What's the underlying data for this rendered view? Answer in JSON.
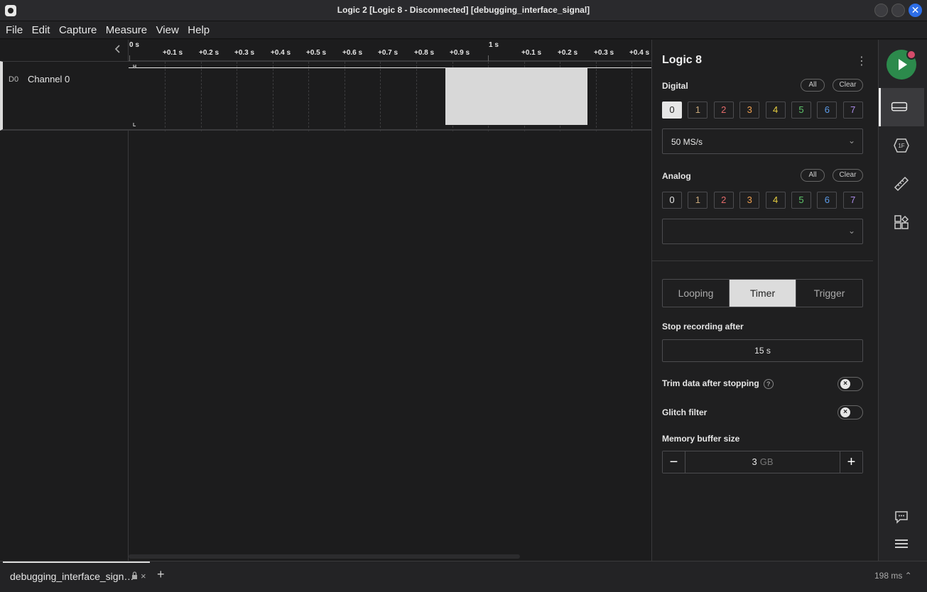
{
  "window": {
    "title": "Logic 2 [Logic 8 - Disconnected] [debugging_interface_signal]",
    "close_glyph": "✕"
  },
  "menu": [
    "File",
    "Edit",
    "Capture",
    "Measure",
    "View",
    "Help"
  ],
  "ruler": {
    "zero_label": "0 s",
    "second_label": "1 s",
    "ticks": [
      "+0.1 s",
      "+0.2 s",
      "+0.3 s",
      "+0.4 s",
      "+0.5 s",
      "+0.6 s",
      "+0.7 s",
      "+0.8 s",
      "+0.9 s",
      "+0.1 s",
      "+0.2 s",
      "+0.3 s",
      "+0.4 s"
    ]
  },
  "channel": {
    "id": "D0",
    "name": "Channel 0",
    "high_marker": "H",
    "low_marker": "L"
  },
  "panel": {
    "device": "Logic 8",
    "kebab": "⋮",
    "digital": {
      "label": "Digital",
      "all": "All",
      "clear": "Clear",
      "channels": [
        {
          "label": "0",
          "color": "#e6e6e6",
          "active": true
        },
        {
          "label": "1",
          "color": "#c8a87a"
        },
        {
          "label": "2",
          "color": "#e56b6b"
        },
        {
          "label": "3",
          "color": "#f0a050"
        },
        {
          "label": "4",
          "color": "#e8d040"
        },
        {
          "label": "5",
          "color": "#5ec46a"
        },
        {
          "label": "6",
          "color": "#5a9ae8"
        },
        {
          "label": "7",
          "color": "#a98ae6"
        }
      ],
      "sample_rate": "50 MS/s"
    },
    "analog": {
      "label": "Analog",
      "all": "All",
      "clear": "Clear",
      "channels": [
        {
          "label": "0",
          "color": "#e6e6e6"
        },
        {
          "label": "1",
          "color": "#c8a87a"
        },
        {
          "label": "2",
          "color": "#e56b6b"
        },
        {
          "label": "3",
          "color": "#f0a050"
        },
        {
          "label": "4",
          "color": "#e8d040"
        },
        {
          "label": "5",
          "color": "#5ec46a"
        },
        {
          "label": "6",
          "color": "#5a9ae8"
        },
        {
          "label": "7",
          "color": "#a98ae6"
        }
      ],
      "sample_rate": ""
    },
    "modes": {
      "looping": "Looping",
      "timer": "Timer",
      "trigger": "Trigger",
      "selected": "Timer"
    },
    "stop_recording_label": "Stop recording after",
    "stop_recording_value": "15 s",
    "trim_label": "Trim data after stopping",
    "trim_help": "?",
    "glitch_label": "Glitch filter",
    "memory_label": "Memory buffer size",
    "memory_value": "3",
    "memory_unit": "GB",
    "minus": "−",
    "plus": "+"
  },
  "sidebar_icons": [
    "device-settings-icon",
    "analyzers-icon",
    "measurements-icon",
    "extensions-icon",
    "feedback-icon",
    "menu-icon"
  ],
  "bottom": {
    "tab_label": "debugging_interface_sign…",
    "tab_close": "×",
    "add_tab": "+",
    "status": "198 ms ⌃"
  }
}
